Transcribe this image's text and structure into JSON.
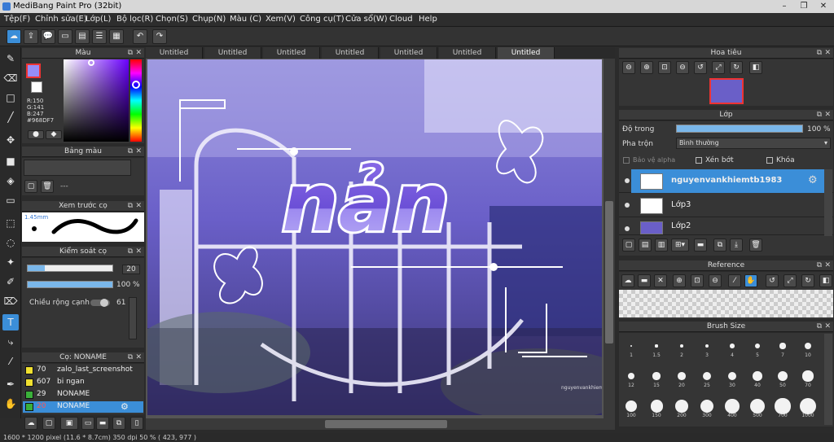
{
  "app": {
    "title": "MediBang Paint Pro (32bit)"
  },
  "window_buttons": {
    "minimize": "–",
    "maximize": "❐",
    "close": "✕"
  },
  "menu": [
    "Tệp(F)",
    "Chỉnh sửa(E)",
    "Lớp(L)",
    "Bộ lọc(R)",
    "Chọn(S)",
    "Chụp(N)",
    "Màu (C)",
    "Xem(V)",
    "Công cụ(T)",
    "Cửa sổ(W)",
    "Cloud",
    "Help"
  ],
  "color_panel": {
    "title": "Màu",
    "r": "R:150",
    "g": "G:141",
    "b": "B:247",
    "hex": "#968DF7",
    "primary_color": "#968df7"
  },
  "palette_panel": {
    "title": "Bảng màu",
    "empty_label": "---"
  },
  "brush_preview_panel": {
    "title": "Xem trước cọ",
    "size": "1.45mm"
  },
  "brush_control_panel": {
    "title": "Kiểm soát cọ",
    "size_value": "20",
    "size_fraction": 0.2,
    "opacity_value": "100 %",
    "opacity_fraction": 1.0,
    "edge_label": "Chiều rộng cạnh",
    "edge_value": "61"
  },
  "brush_list_panel": {
    "title": "Cọ: NONAME",
    "items": [
      {
        "num": "70",
        "name": "zalo_last_screenshot",
        "color": "#f0e030"
      },
      {
        "num": "607",
        "name": "bi ngan",
        "color": "#f0e030"
      },
      {
        "num": "29",
        "name": "NONAME",
        "color": "#3ab03a"
      },
      {
        "num": "20",
        "name": "NONAME",
        "color": "#3ab03a"
      }
    ]
  },
  "tabs": [
    "Untitled",
    "Untitled",
    "Untitled",
    "Untitled",
    "Untitled",
    "Untitled",
    "Untitled"
  ],
  "artwork": {
    "text": "nản"
  },
  "navigator_panel": {
    "title": "Hoa tiêu"
  },
  "layer_panel": {
    "title": "Lớp",
    "opacity_label": "Độ trong",
    "opacity_value": "100 %",
    "opacity_fraction": 1.0,
    "blend_label": "Pha trộn",
    "blend_value": "Bình thường",
    "protect_alpha": "Bảo vệ alpha",
    "clipping": "Xén bớt",
    "lock": "Khóa",
    "layers": [
      {
        "name": "nguyenvankhiemtb1983",
        "selected": true
      },
      {
        "name": "Lớp3",
        "selected": false
      },
      {
        "name": "Lớp2",
        "selected": false
      }
    ]
  },
  "reference_panel": {
    "title": "Reference"
  },
  "brush_size_panel": {
    "title": "Brush Size",
    "sizes": [
      "1",
      "1.5",
      "2",
      "3",
      "4",
      "5",
      "7",
      "10",
      "12",
      "15",
      "20",
      "25",
      "30",
      "40",
      "50",
      "70",
      "100",
      "150",
      "200",
      "300",
      "400",
      "500",
      "700",
      "1000"
    ]
  },
  "status": "1600 * 1200 pixel   (11.6 * 8.7cm)   350 dpi   50 %   ( 423, 977 )"
}
